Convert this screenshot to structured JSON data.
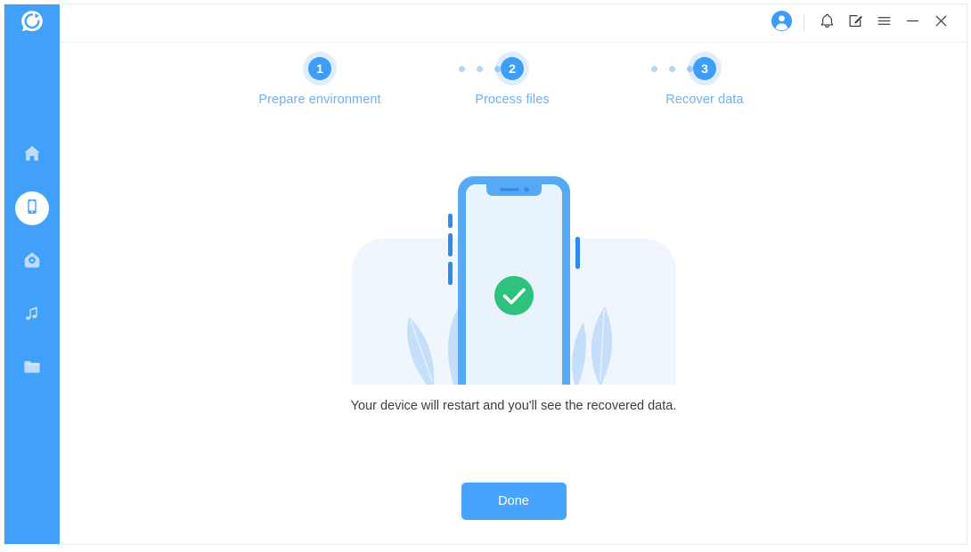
{
  "window": {
    "title": "Data Recovery",
    "accent_color": "#40A0FA",
    "success_color": "#2FC27F",
    "background_color": "#FFFFFF"
  },
  "sidebar": {
    "logo": {
      "icon": "recovery-logo-icon",
      "label": "Recovery"
    },
    "items": [
      {
        "icon": "home-icon",
        "label": "Home",
        "active": false
      },
      {
        "icon": "phone-icon",
        "label": "Phone",
        "active": true
      },
      {
        "icon": "cloud-icon",
        "label": "Cloud Backup",
        "active": false
      },
      {
        "icon": "music-icon",
        "label": "Music",
        "active": false
      },
      {
        "icon": "folder-icon",
        "label": "Files",
        "active": false
      }
    ]
  },
  "titlebar": {
    "controls": [
      {
        "icon": "account-avatar-icon",
        "label": "Account"
      },
      {
        "icon": "bell-icon",
        "label": "Notifications"
      },
      {
        "icon": "feedback-icon",
        "label": "Feedback"
      },
      {
        "icon": "menu-icon",
        "label": "Menu"
      },
      {
        "icon": "minimize-icon",
        "label": "Minimize"
      },
      {
        "icon": "close-icon",
        "label": "Close"
      }
    ]
  },
  "steps": {
    "items": [
      {
        "number": "1",
        "label": "Prepare environment"
      },
      {
        "number": "2",
        "label": "Process files"
      },
      {
        "number": "3",
        "label": "Recover data"
      }
    ],
    "dot_count": 3
  },
  "illustration": {
    "name": "phone-success-illustration",
    "status_icon": "green-check-icon",
    "phone_color": "#55A9F5",
    "screen_color": "#E9F3FC",
    "blob_color": "#EFF6FE",
    "leaf_color": "#C5DEFA",
    "check_color": "#2FC27F"
  },
  "main": {
    "message": "Your device will restart and you'll see the recovered data.",
    "done_label": "Done"
  }
}
